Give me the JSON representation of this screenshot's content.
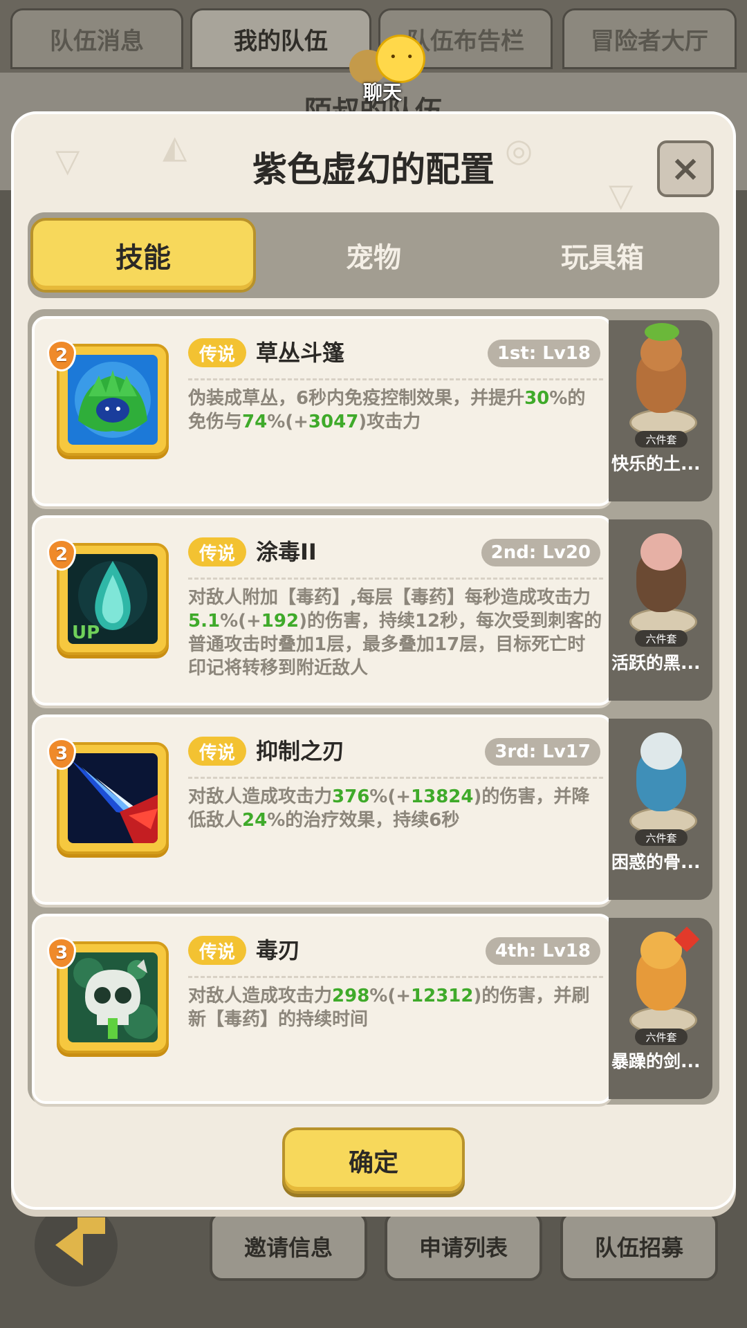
{
  "background": {
    "tabs": [
      "队伍消息",
      "我的队伍",
      "队伍布告栏",
      "冒险者大厅"
    ],
    "active_tab": 1,
    "panel_title": "陌叔的队伍",
    "chat_label": "聊天",
    "bottom_buttons": [
      "邀请信息",
      "申请列表",
      "队伍招募"
    ]
  },
  "modal": {
    "title": "紫色虚幻的配置",
    "close_icon": "×",
    "segments": [
      "技能",
      "宠物",
      "玩具箱"
    ],
    "active_segment": 0,
    "confirm_label": "确定",
    "skills": [
      {
        "badge": "2",
        "rarity": "传说",
        "name": "草丛斗篷",
        "level": "1st: Lv18",
        "icon": "bush-icon",
        "desc": [
          {
            "t": "伪装成草丛，6秒内免疫控制效果，并提升",
            "hl": false
          },
          {
            "t": "30",
            "hl": true
          },
          {
            "t": "%的免伤与",
            "hl": false
          },
          {
            "t": "74",
            "hl": true
          },
          {
            "t": "%(+",
            "hl": false
          },
          {
            "t": "3047",
            "hl": true
          },
          {
            "t": ")攻击力",
            "hl": false
          }
        ],
        "pet_name": "快乐的土...",
        "pet_tag": "六件套"
      },
      {
        "badge": "2",
        "rarity": "传说",
        "name": "涂毒II",
        "level": "2nd: Lv20",
        "icon": "poison-drop-icon",
        "up_label": "UP",
        "desc": [
          {
            "t": "对敌人附加【毒药】,每层【毒药】每秒造成攻击力",
            "hl": false
          },
          {
            "t": "5.1",
            "hl": true
          },
          {
            "t": "%(+",
            "hl": false
          },
          {
            "t": "192",
            "hl": true
          },
          {
            "t": ")的伤害，持续12秒，每次受到刺客的普通攻击时叠加1层，最多叠加17层，目标死亡时印记将转移到附近敌人",
            "hl": false
          }
        ],
        "pet_name": "活跃的黑...",
        "pet_tag": "六件套"
      },
      {
        "badge": "3",
        "rarity": "传说",
        "name": "抑制之刃",
        "level": "3rd: Lv17",
        "icon": "blade-slash-icon",
        "desc": [
          {
            "t": "对敌人造成攻击力",
            "hl": false
          },
          {
            "t": "376",
            "hl": true
          },
          {
            "t": "%(+",
            "hl": false
          },
          {
            "t": "13824",
            "hl": true
          },
          {
            "t": ")的伤害，并降低敌人",
            "hl": false
          },
          {
            "t": "24",
            "hl": true
          },
          {
            "t": "%的治疗效果，持续6秒",
            "hl": false
          }
        ],
        "pet_name": "困惑的骨...",
        "pet_tag": "六件套"
      },
      {
        "badge": "3",
        "rarity": "传说",
        "name": "毒刃",
        "level": "4th: Lv18",
        "icon": "poison-skull-icon",
        "desc": [
          {
            "t": "对敌人造成攻击力",
            "hl": false
          },
          {
            "t": "298",
            "hl": true
          },
          {
            "t": "%(+",
            "hl": false
          },
          {
            "t": "12312",
            "hl": true
          },
          {
            "t": ")的伤害，并刷新【毒药】的持续时间",
            "hl": false
          }
        ],
        "pet_name": "暴躁的剑...",
        "pet_tag": "六件套"
      }
    ]
  }
}
